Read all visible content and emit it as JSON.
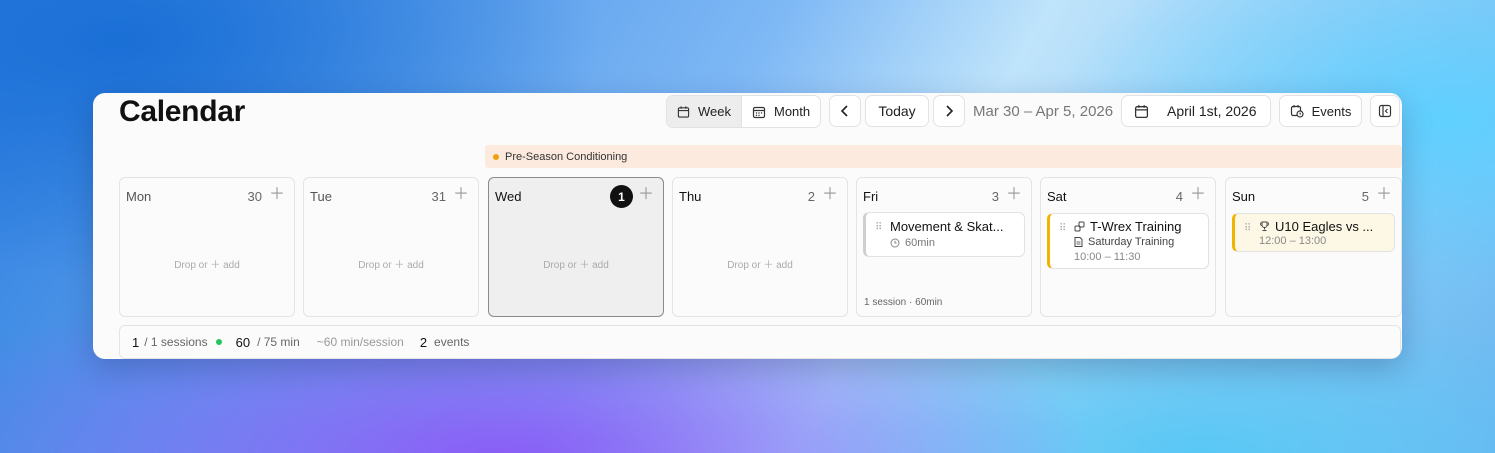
{
  "header": {
    "title": "Calendar",
    "view_week": "Week",
    "view_month": "Month",
    "prev_icon": "chevron-left-icon",
    "next_icon": "chevron-right-icon",
    "today": "Today",
    "range": "Mar 30 – Apr 5, 2026",
    "date_picker": "April 1st, 2026",
    "events": "Events",
    "panel_icon": "sidebar-toggle-icon"
  },
  "banner": {
    "label": "Pre-Season Conditioning",
    "color": "#f0a10a"
  },
  "days": [
    {
      "name": "Mon",
      "num": "30",
      "empty": "Drop or ＋ add"
    },
    {
      "name": "Tue",
      "num": "31",
      "empty": "Drop or ＋ add"
    },
    {
      "name": "Wed",
      "num": "1",
      "empty": "Drop or ＋ add"
    },
    {
      "name": "Thu",
      "num": "2",
      "empty": "Drop or ＋ add"
    },
    {
      "name": "Fri",
      "num": "3",
      "footer": "1 session · 60min",
      "card": {
        "title": "Movement & Skat...",
        "sub": "60min"
      }
    },
    {
      "name": "Sat",
      "num": "4",
      "card": {
        "title": "T-Wrex Training",
        "sub": "Saturday Training",
        "time": "10:00 – 11:30"
      }
    },
    {
      "name": "Sun",
      "num": "5",
      "card": {
        "title": "U10 Eagles vs ...",
        "time": "12:00 – 13:00"
      }
    }
  ],
  "footer": {
    "sessions_done": "1",
    "sessions_total": "/ 1 sessions",
    "minutes_done": "60",
    "minutes_total": "/ 75 min",
    "avg": "~60 min/session",
    "events_count": "2",
    "events_label": "events",
    "status_color": "#22c55e"
  },
  "colors": {
    "accent_yellow": "#f0b400",
    "card_yellow_bg": "#fdf8e6"
  }
}
